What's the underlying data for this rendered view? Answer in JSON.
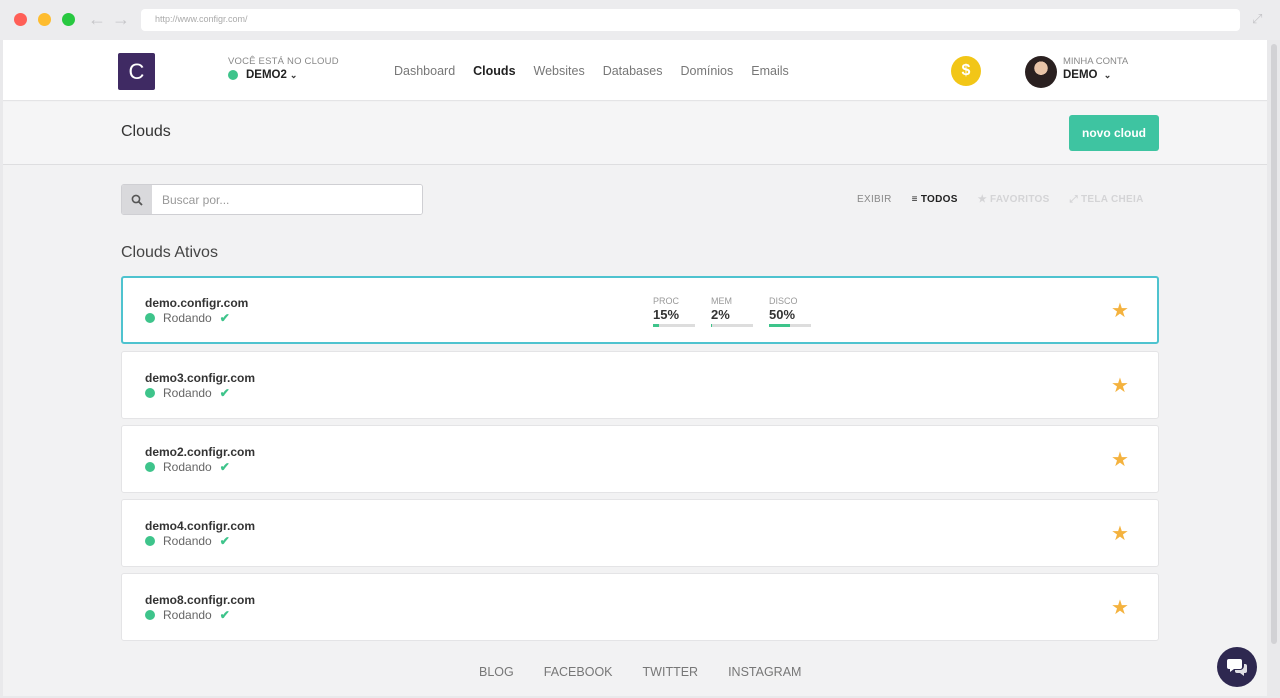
{
  "browser": {
    "url": "http://www.configr.com/"
  },
  "topnav": {
    "logo_letter": "C",
    "cloud_selector_label": "VOCÊ ESTÁ NO CLOUD",
    "cloud_selector_value": "DEMO2",
    "links": [
      "Dashboard",
      "Clouds",
      "Websites",
      "Databases",
      "Domínios",
      "Emails"
    ],
    "active_link": "Clouds",
    "coin_symbol": "$",
    "account_label": "MINHA CONTA",
    "account_value": "DEMO"
  },
  "page": {
    "title": "Clouds",
    "new_button": "novo cloud",
    "search_placeholder": "Buscar por...",
    "filters": {
      "label": "EXIBIR",
      "all": "TODOS",
      "favorites": "FAVORITOS",
      "fullscreen": "TELA CHEIA"
    },
    "section_title": "Clouds Ativos"
  },
  "clouds": [
    {
      "host": "demo.configr.com",
      "status": "Rodando",
      "metrics": [
        {
          "label": "PROC",
          "value": "15%",
          "fraction": 0.15
        },
        {
          "label": "MEM",
          "value": "2%",
          "fraction": 0.02
        },
        {
          "label": "DISCO",
          "value": "50%",
          "fraction": 0.5
        }
      ]
    },
    {
      "host": "demo3.configr.com",
      "status": "Rodando"
    },
    {
      "host": "demo2.configr.com",
      "status": "Rodando"
    },
    {
      "host": "demo4.configr.com",
      "status": "Rodando"
    },
    {
      "host": "demo8.configr.com",
      "status": "Rodando"
    }
  ],
  "footer": {
    "links": [
      "BLOG",
      "FACEBOOK",
      "TWITTER",
      "INSTAGRAM"
    ]
  },
  "colors": {
    "brand": "#3f2a63",
    "accent": "#3ec4a1",
    "status_ok": "#3ec48b",
    "star": "#f4b23e",
    "selected_border": "#4ec3cf"
  },
  "icons": {
    "search": "search-icon",
    "star": "star-icon",
    "check": "check-icon",
    "chat": "chat-icon",
    "coin": "coin-icon"
  }
}
